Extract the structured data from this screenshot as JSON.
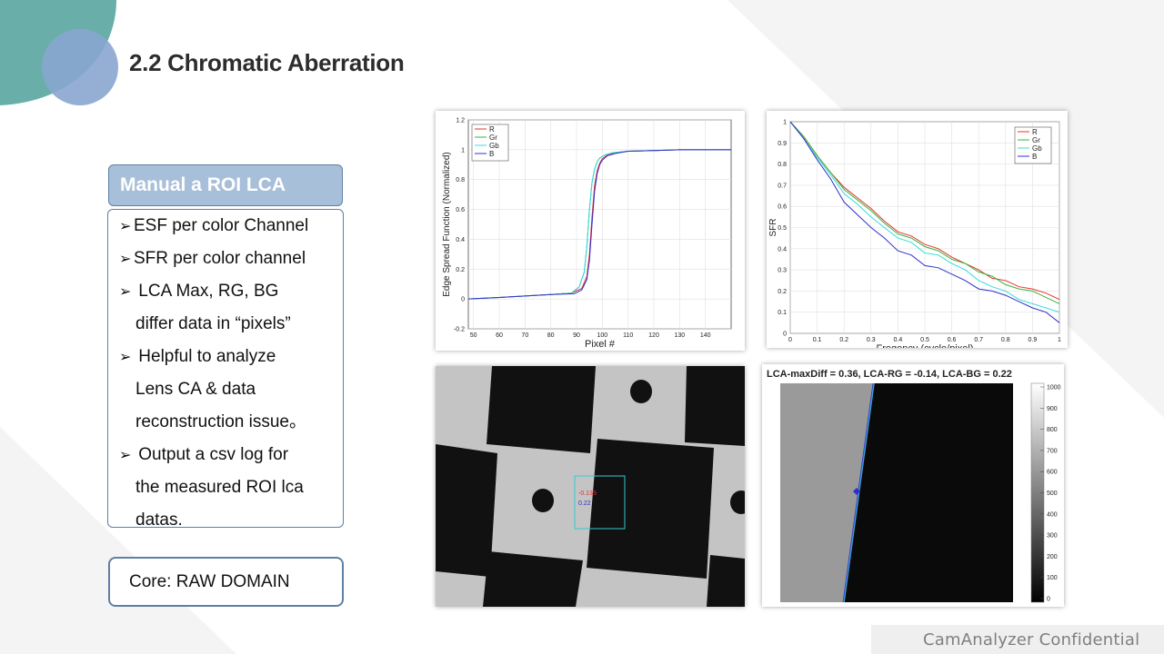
{
  "slide": {
    "title": "2.2  Chromatic Aberration",
    "footer": "CamAnalyzer  Confidential"
  },
  "sidebar": {
    "header": "Manual a ROI LCA",
    "items": [
      {
        "bullet": "➢",
        "lines": [
          "ESF per color Channel"
        ]
      },
      {
        "bullet": "➢",
        "lines": [
          "SFR per color channel"
        ]
      },
      {
        "bullet": "➢",
        "lines": [
          "LCA Max, RG, BG",
          "differ data in “pixels”"
        ]
      },
      {
        "bullet": "➢",
        "lines": [
          "Helpful  to analyze",
          "Lens CA & data",
          "reconstruction issue。"
        ]
      },
      {
        "bullet": "➢",
        "lines": [
          "Output  a csv log for",
          "the measured ROI lca",
          "datas."
        ]
      }
    ],
    "core": "Core: RAW DOMAIN"
  },
  "colors": {
    "R": "#e83030",
    "Gr": "#3bb33b",
    "Gb": "#33dddd",
    "B": "#3030c8",
    "accent": "#5f7fa5"
  },
  "chart_data": [
    {
      "type": "line",
      "title": "",
      "xlabel": "Pixel #",
      "ylabel": "Edge Spread Function (Normalized)",
      "xlim": [
        48,
        150
      ],
      "ylim": [
        -0.2,
        1.2
      ],
      "xticks": [
        50,
        60,
        70,
        80,
        90,
        100,
        110,
        120,
        130,
        140
      ],
      "yticks": [
        -0.2,
        0,
        0.2,
        0.4,
        0.6,
        0.8,
        1,
        1.2
      ],
      "legend": "top-left",
      "grid": true,
      "series": [
        {
          "name": "R",
          "x": [
            48,
            60,
            70,
            80,
            88,
            92,
            94,
            95,
            96,
            97,
            98,
            99,
            100,
            102,
            105,
            110,
            120,
            130,
            140,
            150
          ],
          "y": [
            0.0,
            0.01,
            0.02,
            0.03,
            0.04,
            0.07,
            0.15,
            0.3,
            0.55,
            0.76,
            0.86,
            0.91,
            0.94,
            0.965,
            0.98,
            0.99,
            0.995,
            1.0,
            1.0,
            1.0
          ]
        },
        {
          "name": "Gr",
          "x": [
            48,
            60,
            70,
            80,
            88,
            91,
            93,
            94,
            95,
            96,
            97,
            98,
            99,
            101,
            104,
            110,
            120,
            130,
            140,
            150
          ],
          "y": [
            0.0,
            0.01,
            0.02,
            0.03,
            0.04,
            0.08,
            0.18,
            0.35,
            0.6,
            0.78,
            0.87,
            0.92,
            0.945,
            0.965,
            0.98,
            0.99,
            0.995,
            1.0,
            1.0,
            1.0
          ]
        },
        {
          "name": "Gb",
          "x": [
            48,
            60,
            70,
            80,
            88,
            91,
            93,
            94,
            95,
            96,
            97,
            98,
            99,
            101,
            104,
            110,
            120,
            130,
            140,
            150
          ],
          "y": [
            0.0,
            0.01,
            0.02,
            0.03,
            0.04,
            0.08,
            0.18,
            0.35,
            0.6,
            0.78,
            0.87,
            0.92,
            0.945,
            0.965,
            0.98,
            0.99,
            0.995,
            1.0,
            1.0,
            1.0
          ]
        },
        {
          "name": "B",
          "x": [
            48,
            60,
            70,
            80,
            89,
            92,
            94,
            95,
            96,
            97,
            98,
            99,
            100,
            102,
            105,
            110,
            120,
            130,
            140,
            150
          ],
          "y": [
            0.0,
            0.01,
            0.02,
            0.03,
            0.035,
            0.06,
            0.13,
            0.26,
            0.5,
            0.72,
            0.84,
            0.9,
            0.93,
            0.96,
            0.975,
            0.99,
            0.995,
            1.0,
            1.0,
            1.0
          ]
        }
      ]
    },
    {
      "type": "line",
      "title": "",
      "xlabel": "Freqency (cycle/pixel)",
      "ylabel": "SFR",
      "xlim": [
        0,
        1
      ],
      "ylim": [
        0,
        1
      ],
      "xticks": [
        0,
        0.1,
        0.2,
        0.3,
        0.4,
        0.5,
        0.6,
        0.7,
        0.8,
        0.9,
        1
      ],
      "yticks": [
        0,
        0.1,
        0.2,
        0.3,
        0.4,
        0.5,
        0.6,
        0.7,
        0.8,
        0.9,
        1
      ],
      "legend": "top-right",
      "grid": true,
      "series": [
        {
          "name": "R",
          "x": [
            0,
            0.05,
            0.1,
            0.15,
            0.2,
            0.25,
            0.3,
            0.35,
            0.4,
            0.45,
            0.5,
            0.55,
            0.6,
            0.65,
            0.7,
            0.75,
            0.8,
            0.85,
            0.9,
            0.95,
            1
          ],
          "y": [
            1.0,
            0.93,
            0.84,
            0.76,
            0.69,
            0.64,
            0.59,
            0.53,
            0.48,
            0.46,
            0.42,
            0.4,
            0.36,
            0.33,
            0.3,
            0.26,
            0.25,
            0.22,
            0.21,
            0.19,
            0.16
          ]
        },
        {
          "name": "Gr",
          "x": [
            0,
            0.05,
            0.1,
            0.15,
            0.2,
            0.25,
            0.3,
            0.35,
            0.4,
            0.45,
            0.5,
            0.55,
            0.6,
            0.65,
            0.7,
            0.75,
            0.8,
            0.85,
            0.9,
            0.95,
            1
          ],
          "y": [
            1.0,
            0.93,
            0.84,
            0.76,
            0.68,
            0.63,
            0.58,
            0.52,
            0.47,
            0.45,
            0.41,
            0.39,
            0.35,
            0.33,
            0.29,
            0.27,
            0.23,
            0.21,
            0.2,
            0.17,
            0.14
          ]
        },
        {
          "name": "Gb",
          "x": [
            0,
            0.05,
            0.1,
            0.15,
            0.2,
            0.25,
            0.3,
            0.35,
            0.4,
            0.45,
            0.5,
            0.55,
            0.6,
            0.65,
            0.7,
            0.75,
            0.8,
            0.85,
            0.9,
            0.95,
            1
          ],
          "y": [
            1.0,
            0.92,
            0.83,
            0.75,
            0.66,
            0.61,
            0.55,
            0.5,
            0.45,
            0.43,
            0.38,
            0.37,
            0.33,
            0.3,
            0.25,
            0.22,
            0.2,
            0.16,
            0.14,
            0.12,
            0.1
          ]
        },
        {
          "name": "B",
          "x": [
            0,
            0.05,
            0.1,
            0.15,
            0.2,
            0.25,
            0.3,
            0.35,
            0.4,
            0.45,
            0.5,
            0.55,
            0.6,
            0.65,
            0.7,
            0.75,
            0.8,
            0.85,
            0.9,
            0.95,
            1
          ],
          "y": [
            1.0,
            0.92,
            0.82,
            0.73,
            0.62,
            0.56,
            0.5,
            0.45,
            0.39,
            0.37,
            0.32,
            0.31,
            0.28,
            0.25,
            0.21,
            0.2,
            0.18,
            0.15,
            0.12,
            0.1,
            0.05
          ]
        }
      ]
    }
  ],
  "roi_image": {
    "labels": [
      "-0.139",
      "0.22"
    ]
  },
  "lca_image": {
    "title": "LCA-maxDiff = 0.36, LCA-RG = -0.14, LCA-BG = 0.22",
    "colorbar_ticks": [
      "1000",
      "900",
      "800",
      "700",
      "600",
      "500",
      "400",
      "300",
      "200",
      "100",
      "0"
    ]
  }
}
